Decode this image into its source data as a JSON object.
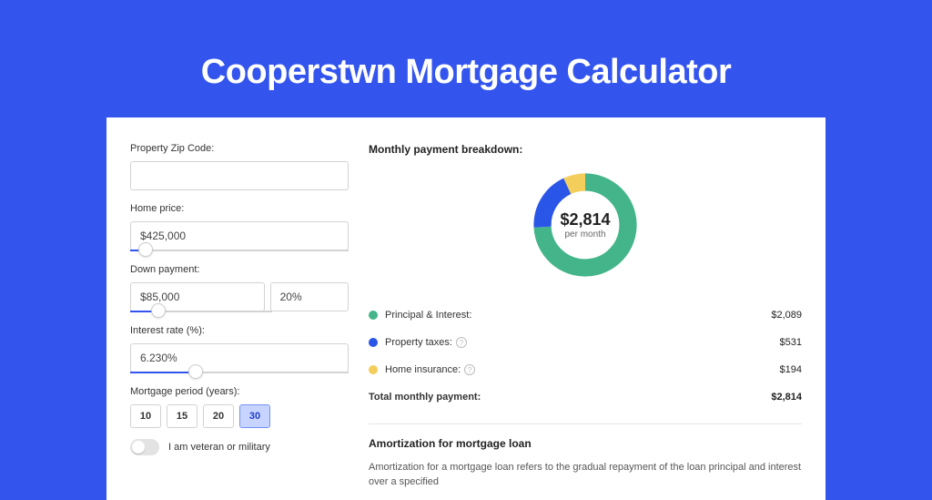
{
  "page": {
    "title": "Cooperstwn Mortgage Calculator"
  },
  "form": {
    "zip_label": "Property Zip Code:",
    "zip_value": "",
    "home_price_label": "Home price:",
    "home_price_value": "$425,000",
    "home_price_slider_pct": 7,
    "down_payment_label": "Down payment:",
    "down_payment_amount": "$85,000",
    "down_payment_pct": "20%",
    "down_payment_slider_pct": 20,
    "interest_label": "Interest rate (%):",
    "interest_value": "6.230%",
    "interest_slider_pct": 30,
    "period_label": "Mortgage period (years):",
    "periods": [
      "10",
      "15",
      "20",
      "30"
    ],
    "period_active_index": 3,
    "veteran_label": "I am veteran or military"
  },
  "breakdown": {
    "title": "Monthly payment breakdown:",
    "center_amount": "$2,814",
    "center_sub": "per month",
    "rows": [
      {
        "label": "Principal & Interest:",
        "value": "$2,089",
        "color": "#44b58a",
        "info": false
      },
      {
        "label": "Property taxes:",
        "value": "$531",
        "color": "#2a56e8",
        "info": true
      },
      {
        "label": "Home insurance:",
        "value": "$194",
        "color": "#f4ce5a",
        "info": true
      }
    ],
    "total_label": "Total monthly payment:",
    "total_value": "$2,814"
  },
  "amortization": {
    "title": "Amortization for mortgage loan",
    "body": "Amortization for a mortgage loan refers to the gradual repayment of the loan principal and interest over a specified"
  },
  "chart_data": {
    "type": "pie",
    "title": "Monthly payment breakdown",
    "series": [
      {
        "name": "Principal & Interest",
        "value": 2089,
        "color": "#44b58a"
      },
      {
        "name": "Property taxes",
        "value": 531,
        "color": "#2a56e8"
      },
      {
        "name": "Home insurance",
        "value": 194,
        "color": "#f4ce5a"
      }
    ],
    "total": 2814,
    "center_label": "$2,814 per month"
  }
}
